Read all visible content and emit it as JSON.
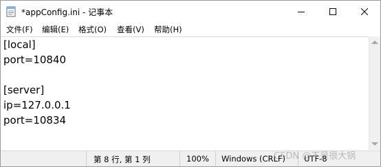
{
  "window": {
    "title": "*appConfig.ini - 记事本",
    "app_icon": "notepad-icon",
    "controls": {
      "minimize": "minimize-icon",
      "maximize": "maximize-icon",
      "close": "close-icon"
    }
  },
  "menu": {
    "items": [
      {
        "label": "文件(F)"
      },
      {
        "label": "编辑(E)"
      },
      {
        "label": "格式(O)"
      },
      {
        "label": "查看(V)"
      },
      {
        "label": "帮助(H)"
      }
    ]
  },
  "editor": {
    "lines": [
      "[local]",
      "port=10840",
      "",
      "[server]",
      "ip=127.0.0.1",
      "port=10834"
    ]
  },
  "status": {
    "position": "第 8 行, 第 1 列",
    "zoom": "100%",
    "line_ending": "Windows (CRLF)",
    "encoding": "UTF-8"
  },
  "watermark": "CSDN @不是很大锅"
}
